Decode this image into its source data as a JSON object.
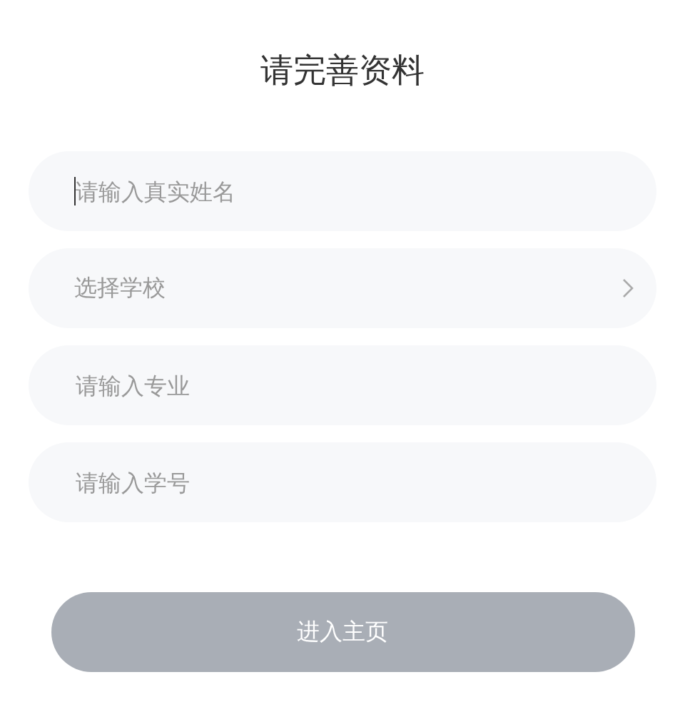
{
  "title": "请完善资料",
  "fields": [
    {
      "kind": "input",
      "placeholder": "请输入真实姓名",
      "focused": true
    },
    {
      "kind": "select",
      "placeholder": "选择学校",
      "focused": false
    },
    {
      "kind": "input",
      "placeholder": "请输入专业",
      "focused": false
    },
    {
      "kind": "input",
      "placeholder": "请输入学号",
      "focused": false
    }
  ],
  "submit": {
    "label": "进入主页",
    "disabled": true
  }
}
